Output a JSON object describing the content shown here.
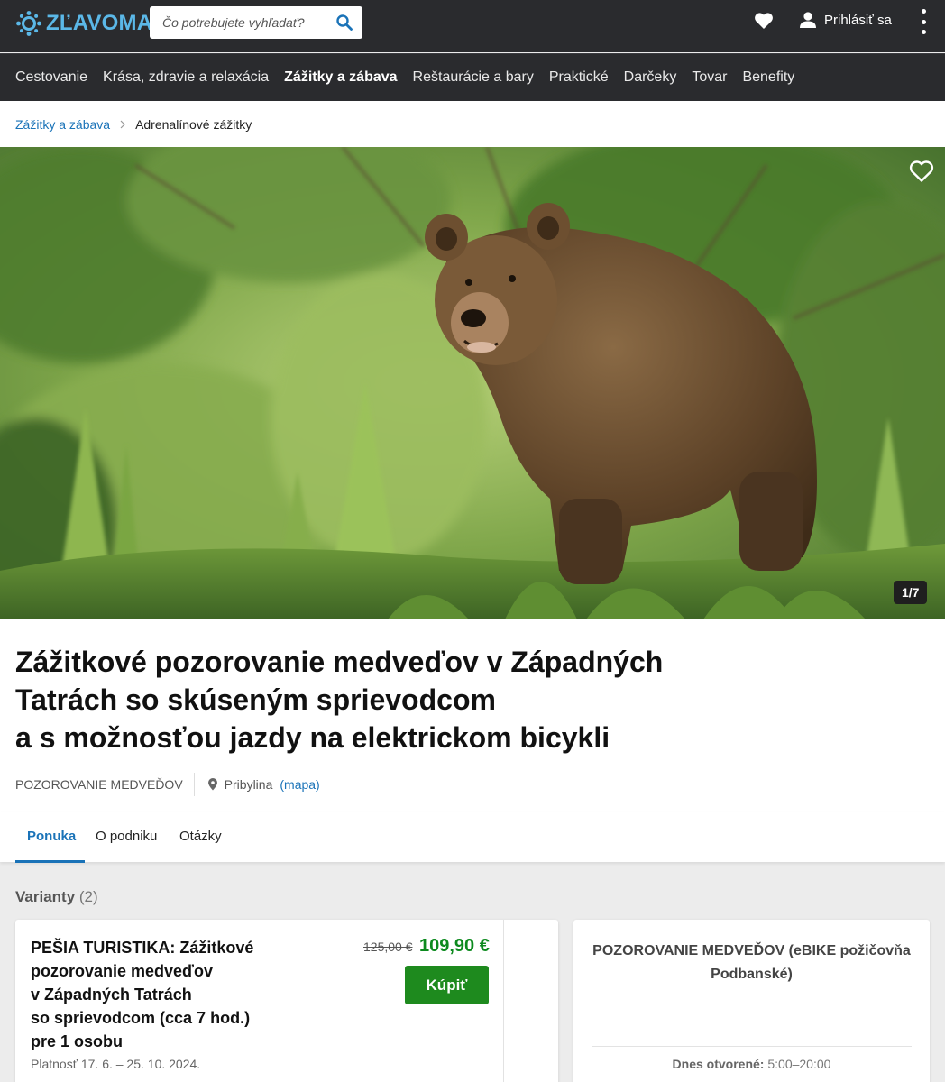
{
  "header": {
    "logo_text": "ZĽAVOMAT",
    "search_placeholder": "Čo potrebujete vyhľadať?",
    "login_label": "Prihlásiť sa",
    "colors": {
      "bar": "#2a2b2e",
      "logo": "#5bb8e8"
    }
  },
  "categories": [
    {
      "label": "Cestovanie"
    },
    {
      "label": "Krása, zdravie a relaxácia"
    },
    {
      "label": "Zážitky a zábava",
      "active": true
    },
    {
      "label": "Reštaurácie a bary"
    },
    {
      "label": "Praktické"
    },
    {
      "label": "Darčeky"
    },
    {
      "label": "Tovar"
    },
    {
      "label": "Benefity"
    }
  ],
  "breadcrumb": {
    "parent": "Zážitky a zábava",
    "current": "Adrenalínové zážitky"
  },
  "gallery": {
    "counter": "1/7"
  },
  "offer": {
    "title_lines": [
      "Zážitkové pozorovanie medveďov v Západných",
      "Tatrách so skúseným sprievodcom",
      "a s možnosťou jazdy na elektrickom bicykli"
    ],
    "vendor": "POZOROVANIE MEDVEĎOV",
    "location": "Pribylina",
    "map_link": "(mapa)"
  },
  "tabs": [
    {
      "label": "Ponuka",
      "active": true
    },
    {
      "label": "O podniku"
    },
    {
      "label": "Otázky"
    }
  ],
  "variants": {
    "heading": "Varianty",
    "count": "(2)",
    "items": [
      {
        "title_lines": [
          "PEŠIA TURISTIKA: Zážitkové",
          "pozorovanie medveďov",
          "v Západných Tatrách",
          "so sprievodcom (cca 7 hod.)",
          "pre 1 osobu"
        ],
        "old_price": "125,00 €",
        "price": "109,90 €",
        "buy_label": "Kúpiť",
        "validity": "Platnosť 17. 6. – 25. 10. 2024."
      }
    ]
  },
  "vendor_card": {
    "title_lines": [
      "POZOROVANIE MEDVEĎOV (eBIKE požičovňa",
      "Podbanské)"
    ],
    "hours_label": "Dnes otvorené:",
    "hours_value": "5:00–20:00"
  }
}
